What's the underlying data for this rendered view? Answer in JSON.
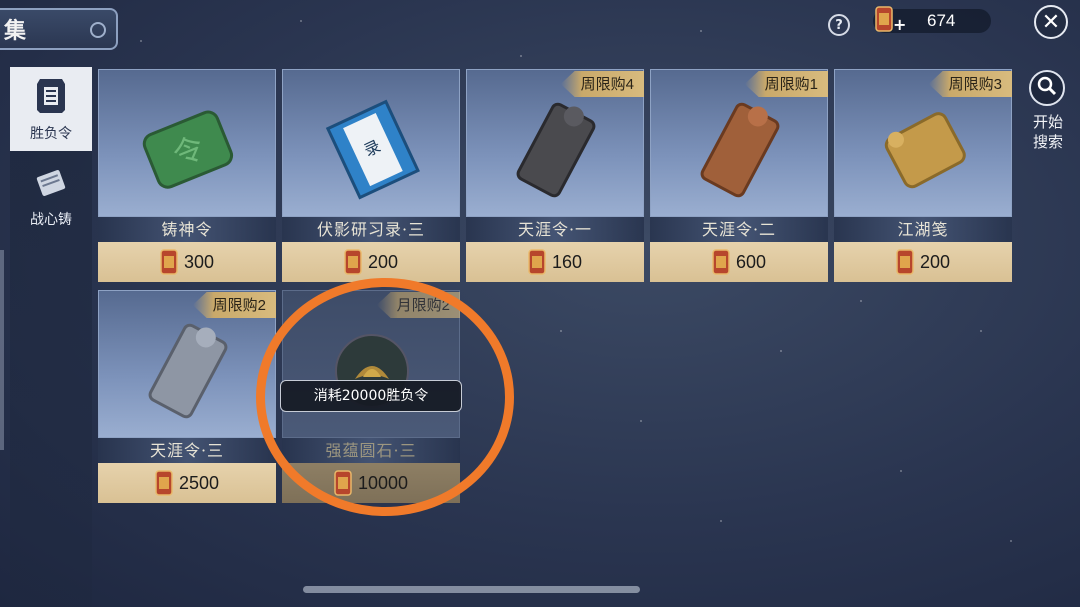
{
  "header": {
    "title": "集"
  },
  "currency": {
    "amount": "674",
    "plus": "+"
  },
  "help": {
    "label": "?"
  },
  "close": {
    "label": "✕"
  },
  "sidebar": {
    "items": [
      {
        "label": "胜负令",
        "icon": "victory-token-icon",
        "active": true
      },
      {
        "label": "战心铸",
        "icon": "scroll-icon",
        "active": false
      }
    ]
  },
  "search": {
    "line1": "开始",
    "line2": "搜索"
  },
  "shop": {
    "items": [
      {
        "name": "铸神令",
        "price": "300",
        "limit_text": "",
        "limit_num": "",
        "color": "#3f8a4e"
      },
      {
        "name": "伏影研习录·三",
        "price": "200",
        "limit_text": "",
        "limit_num": "",
        "color": "#2f82c8"
      },
      {
        "name": "天涯令·一",
        "price": "160",
        "limit_text": "周限购",
        "limit_num": "4",
        "color": "#4a4a4e"
      },
      {
        "name": "天涯令·二",
        "price": "600",
        "limit_text": "周限购",
        "limit_num": "1",
        "color": "#a0603a"
      },
      {
        "name": "江湖笺",
        "price": "200",
        "limit_text": "周限购",
        "limit_num": "3",
        "color": "#c49a4a"
      },
      {
        "name": "天涯令·三",
        "price": "2500",
        "limit_text": "周限购",
        "limit_num": "2",
        "color": "#8e96a4"
      },
      {
        "name": "强蕴圆石·三",
        "price": "10000",
        "limit_text": "月限购",
        "limit_num": "2",
        "color": "#2d3a3a"
      }
    ]
  },
  "tooltip": {
    "text": "消耗20000胜负令"
  }
}
